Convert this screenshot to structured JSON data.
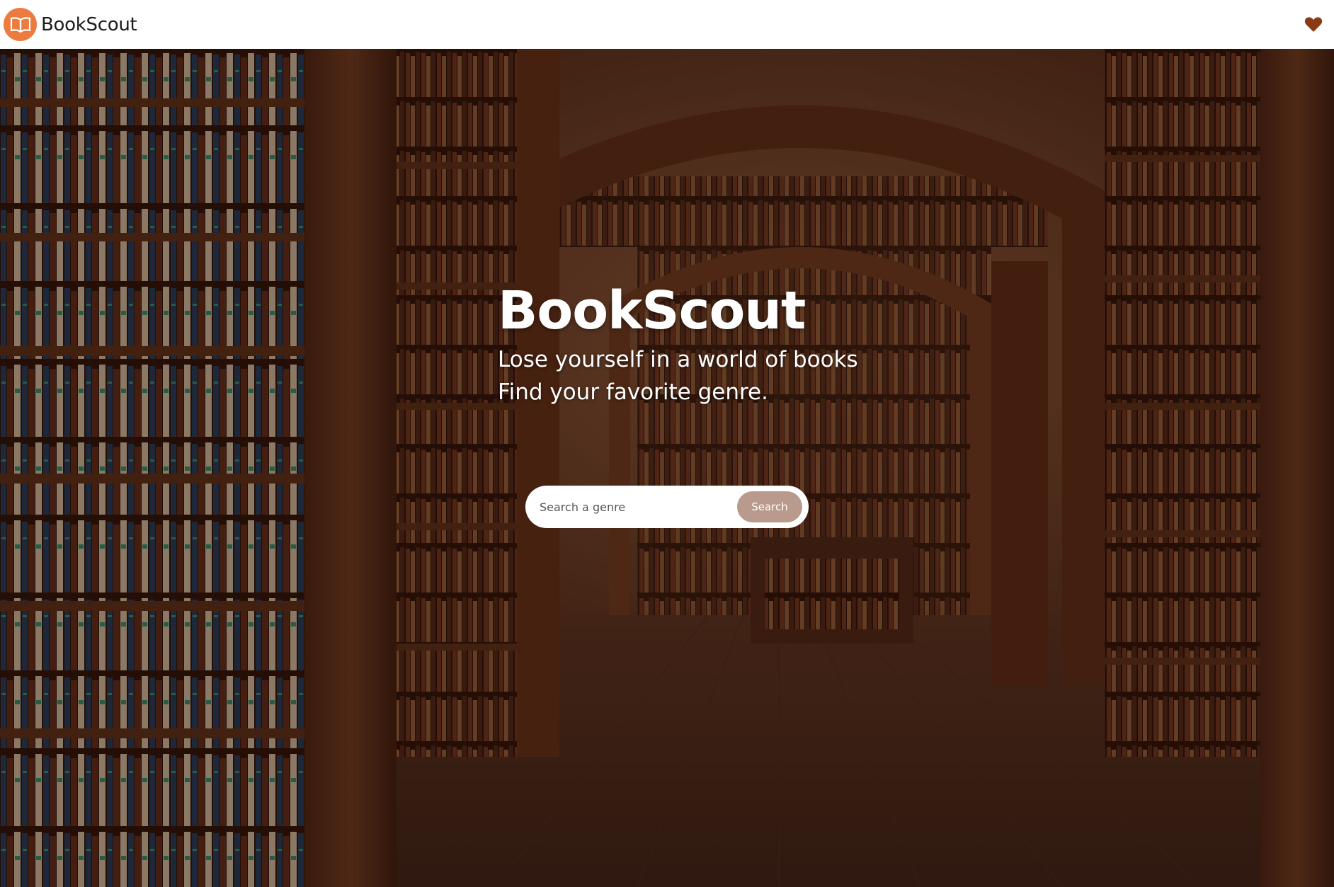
{
  "navbar": {
    "brand_name": "BookScout",
    "logo_icon": "open-book-icon",
    "favorites_icon": "heart-icon",
    "accent_color": "#ec7b3f",
    "heart_color": "#8a3a14"
  },
  "hero": {
    "title": "BookScout",
    "subtitle_line1": "Lose yourself in a world of books",
    "subtitle_line2": "Find your favorite genre.",
    "background_image": "library-interior"
  },
  "search": {
    "placeholder": "Search a genre",
    "value": "",
    "button_label": "Search",
    "button_color": "#b99a8d"
  }
}
